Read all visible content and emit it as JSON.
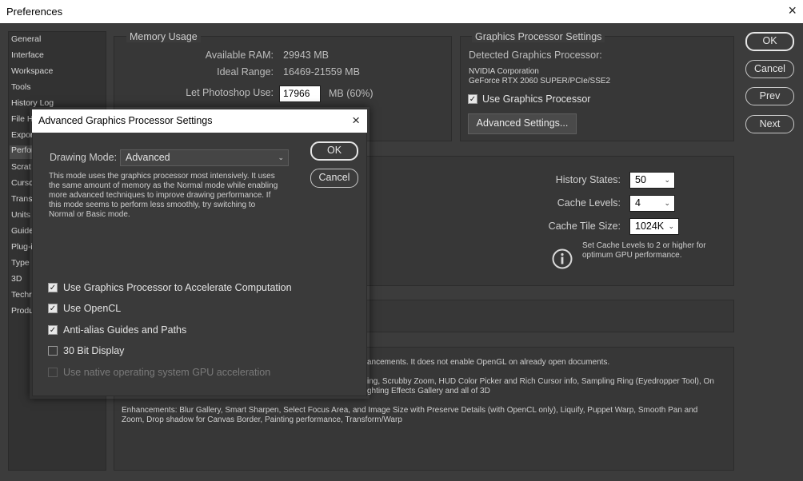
{
  "window": {
    "title": "Preferences",
    "close_icon": "×"
  },
  "sidebar": {
    "items": [
      {
        "label": "General"
      },
      {
        "label": "Interface"
      },
      {
        "label": "Workspace"
      },
      {
        "label": "Tools"
      },
      {
        "label": "History Log"
      },
      {
        "label": "File Ha"
      },
      {
        "label": "Expor"
      },
      {
        "label": "Perfor"
      },
      {
        "label": "Scrat"
      },
      {
        "label": "Curso"
      },
      {
        "label": "Trans"
      },
      {
        "label": "Units"
      },
      {
        "label": "Guide"
      },
      {
        "label": "Plug-i"
      },
      {
        "label": "Type"
      },
      {
        "label": "3D"
      },
      {
        "label": "Techr"
      },
      {
        "label": "Produ"
      }
    ],
    "selected_index": 7
  },
  "memory_usage": {
    "title": "Memory Usage",
    "available_ram_label": "Available RAM:",
    "available_ram_value": "29943 MB",
    "ideal_range_label": "Ideal Range:",
    "ideal_range_value": "16469-21559 MB",
    "let_photoshop_use_label": "Let Photoshop Use:",
    "let_photoshop_use_value": "17966",
    "let_photoshop_use_suffix": "MB (60%)"
  },
  "gpu_settings": {
    "title": "Graphics Processor Settings",
    "detected_label": "Detected Graphics Processor:",
    "gpu_vendor": "NVIDIA Corporation",
    "gpu_model": "GeForce RTX 2060 SUPER/PCIe/SSE2",
    "use_gpu_label": "Use Graphics Processor",
    "use_gpu_checked": true,
    "advanced_button": "Advanced Settings..."
  },
  "history_cache": {
    "history_states_label": "History States:",
    "history_states_value": "50",
    "cache_levels_label": "Cache Levels:",
    "cache_levels_value": "4",
    "cache_tile_size_label": "Cache Tile Size:",
    "cache_tile_size_value": "1024K",
    "info_line1": "Set Cache Levels to 2 or higher for",
    "info_line2": "optimum GPU performance."
  },
  "description": {
    "line1": "ancements. It does not enable OpenGL on already open documents.",
    "line2": "ing, Scrubby Zoom, HUD Color Picker and Rich Cursor info, Sampling Ring (Eyedropper Tool), On",
    "line3": "ghting Effects Gallery and all of 3D",
    "line4": "Enhancements: Blur Gallery, Smart Sharpen, Select Focus Area, and Image Size with Preserve Details (with OpenCL only), Liquify, Puppet Warp, Smooth Pan and",
    "line5": "Zoom, Drop shadow for Canvas Border, Painting performance, Transform/Warp"
  },
  "buttons": {
    "ok": "OK",
    "cancel": "Cancel",
    "prev": "Prev",
    "next": "Next"
  },
  "modal": {
    "title": "Advanced Graphics Processor Settings",
    "close_icon": "×",
    "drawing_mode_label": "Drawing Mode:",
    "drawing_mode_value": "Advanced",
    "mode_desc": [
      "This mode uses the graphics processor most intensively.  It uses",
      "the same amount of memory as the Normal mode while enabling",
      "more advanced techniques to improve drawing performance.  If",
      "this mode seems to perform less smoothly, try switching to",
      "Normal or Basic mode."
    ],
    "ok": "OK",
    "cancel": "Cancel",
    "options": [
      {
        "label": "Use Graphics Processor to Accelerate Computation",
        "checked": true,
        "disabled": false
      },
      {
        "label": "Use OpenCL",
        "checked": true,
        "disabled": false
      },
      {
        "label": "Anti-alias Guides and Paths",
        "checked": true,
        "disabled": false
      },
      {
        "label": "30 Bit Display",
        "checked": false,
        "disabled": false
      },
      {
        "label": "Use native operating system GPU acceleration",
        "checked": false,
        "disabled": true
      }
    ]
  },
  "colors": {
    "background": "#3c3c3c",
    "panel": "#373737",
    "sidebar": "#323232",
    "modal": "#3a3a3a"
  }
}
